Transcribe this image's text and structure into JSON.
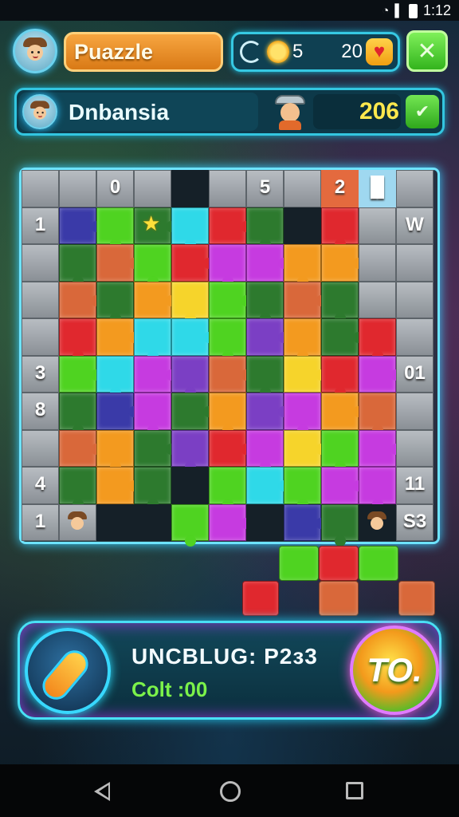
{
  "status_bar": {
    "time": "1:12"
  },
  "header": {
    "game_title": "Puazzle",
    "stats": {
      "moves": "5",
      "lives": "20"
    }
  },
  "player": {
    "name": "Dnbansia",
    "score": "206"
  },
  "board": {
    "top_clues": [
      "0",
      "5",
      "2",
      "▐▌"
    ],
    "left_clues": [
      "1",
      "3",
      "8",
      "4",
      "1"
    ],
    "right_clues": [
      "W",
      "01",
      "11",
      "S3"
    ]
  },
  "action": {
    "title": "UNCBLUG: P2з3",
    "cost": "Colt :00",
    "go_label": "TO."
  },
  "colors": {
    "green": "#4fd321",
    "cyan": "#2fd9e8",
    "magenta": "#c63be0",
    "red": "#e0282e",
    "orange": "#f39a1f",
    "yellow": "#f6d42b",
    "navy": "#3a3aa8",
    "jungle": "#2d7a2e",
    "sunset": "#d9683a",
    "purple": "#7b3fc4",
    "brown": "#a4502a"
  }
}
